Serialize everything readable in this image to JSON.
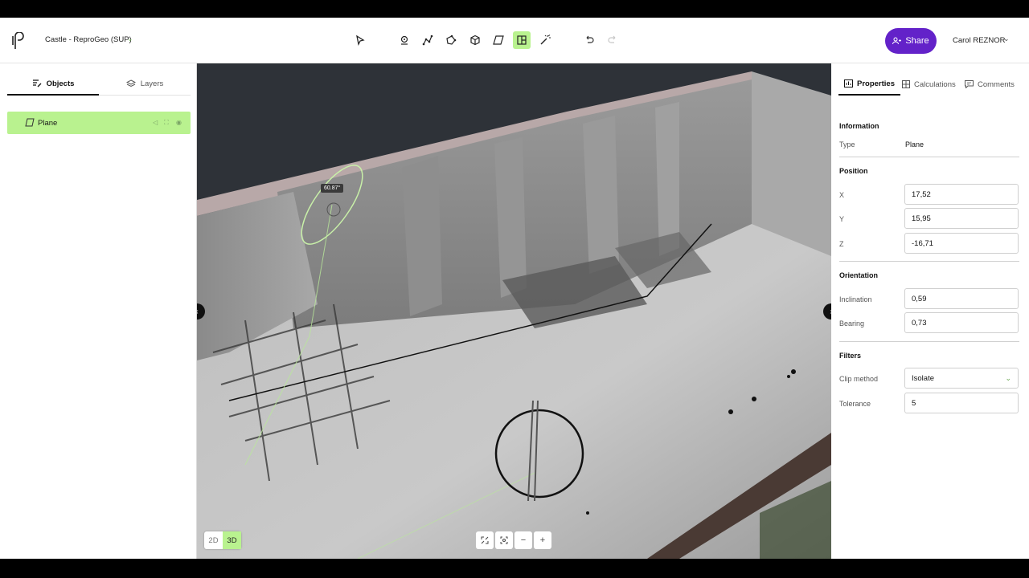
{
  "header": {
    "project_title": "Castle - ReproGeo (SUP)",
    "tools": [
      "select-icon",
      "point-icon",
      "polyline-icon",
      "polygon-icon",
      "box-icon",
      "plane-icon",
      "clip-plane-icon",
      "magic-wand-icon",
      "undo-icon",
      "redo-icon"
    ],
    "active_tool": "clip-plane-icon",
    "share_label": "Share",
    "user_name": "Carol REZNOR",
    "accent_color": "#6322c9",
    "highlight_color": "#b9f28f"
  },
  "left_panel": {
    "tabs": [
      {
        "label": "Objects",
        "active": true
      },
      {
        "label": "Layers",
        "active": false
      }
    ],
    "objects": [
      {
        "name": "Plane",
        "selected": true
      }
    ]
  },
  "viewport": {
    "angle_label": "60.87°",
    "mode_2d": "2D",
    "mode_3d": "3D",
    "active_mode": "3D",
    "zoom_controls": [
      "fullscreen-icon",
      "fit-icon",
      "zoom-out-icon",
      "zoom-in-icon"
    ],
    "zoom_out_label": "−",
    "zoom_in_label": "+"
  },
  "right_panel": {
    "tabs": [
      {
        "label": "Properties",
        "active": true
      },
      {
        "label": "Calculations",
        "active": false
      },
      {
        "label": "Comments",
        "active": false
      }
    ],
    "information": {
      "title": "Information",
      "type_label": "Type",
      "type_value": "Plane"
    },
    "position": {
      "title": "Position",
      "x_label": "X",
      "x_value": "17,52",
      "y_label": "Y",
      "y_value": "15,95",
      "z_label": "Z",
      "z_value": "-16,71"
    },
    "orientation": {
      "title": "Orientation",
      "inclination_label": "Inclination",
      "inclination_value": "0,59",
      "bearing_label": "Bearing",
      "bearing_value": "0,73"
    },
    "filters": {
      "title": "Filters",
      "clip_method_label": "Clip method",
      "clip_method_value": "Isolate",
      "tolerance_label": "Tolerance",
      "tolerance_value": "5"
    }
  }
}
